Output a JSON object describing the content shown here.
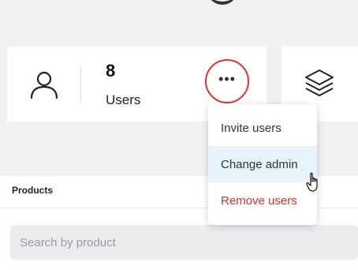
{
  "users_card": {
    "icon": "user-icon",
    "count": "8",
    "label": "Users",
    "more_icon": "more-horizontal-icon"
  },
  "products_card": {
    "icon": "layers-icon"
  },
  "products_section": {
    "title": "Products",
    "search_placeholder": "Search by product"
  },
  "menu": {
    "items": [
      {
        "label": "Invite users"
      },
      {
        "label": "Change admin"
      },
      {
        "label": "Remove users"
      }
    ]
  },
  "colors": {
    "accent_red": "#e0322b",
    "highlight": "#e8f2fb"
  }
}
